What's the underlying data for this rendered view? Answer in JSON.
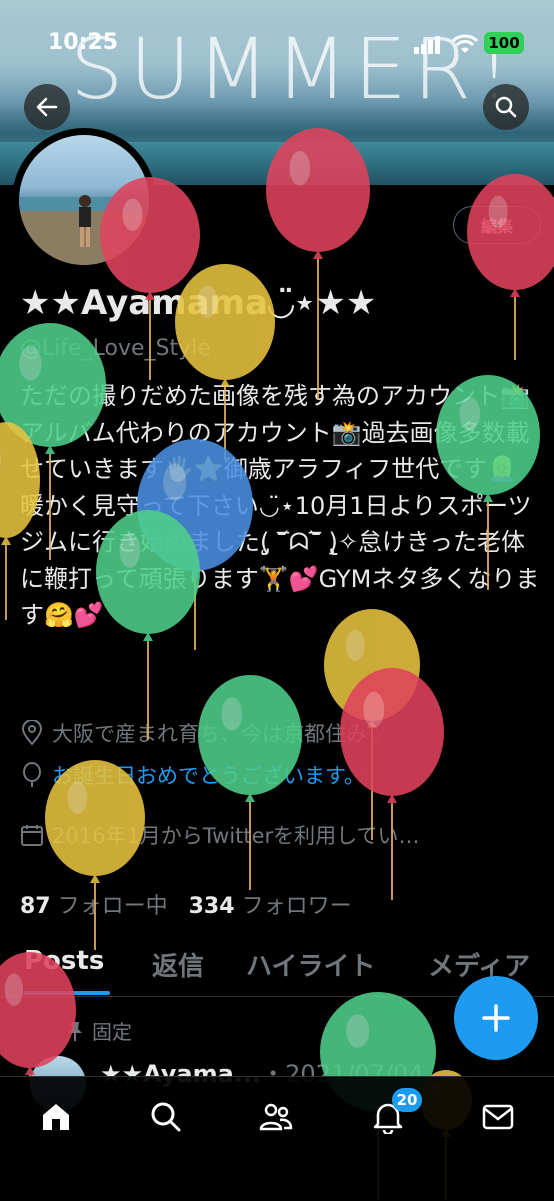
{
  "status_bar": {
    "time": "10:25",
    "battery": "100"
  },
  "banner": {
    "text": "SUMMER!"
  },
  "header": {
    "edit_label": "編集"
  },
  "profile": {
    "name": "★★Ayamama◡̈⋆★★",
    "handle": "@Life_Love_Style",
    "bio": "ただの撮りだめた画像を残す為のアカウント📸アルバム代わりのアカウント📸過去画像多数載せていきます🖐⭐️御歳アラフィフ世代です👱‍♀️暖かく見守って下さい◡̈⋆10月1日よりスポーツジムに行き始めました(̨̡ ‾᷄ᗣ‾᷅ )̧̢✧怠けきった老体に鞭打って頑張ります🏋️💕GYMネタ多くなります🤗💕",
    "location": "大阪で産まれ育ち、今は京都住み♡",
    "birthday": "お誕生日おめでとうございます。",
    "joined": "2016年1月からTwitterを利用してい…",
    "following_count": "87",
    "following_label": "フォロー中",
    "followers_count": "334",
    "followers_label": "フォロワー"
  },
  "tabs": [
    "Posts",
    "返信",
    "ハイライト",
    "メディア"
  ],
  "pinned_label": "固定",
  "post": {
    "author": "★★Ayama...",
    "date": "・2021/07/04"
  },
  "nav": {
    "notifications_badge": "20"
  },
  "colors": {
    "accent": "#1d9bf0",
    "battery": "#31d158"
  },
  "decor": {
    "balloons": [
      {
        "color": "#e0435c"
      },
      {
        "color": "#e0435c"
      },
      {
        "color": "#e0435c"
      },
      {
        "color": "#e8c340"
      },
      {
        "color": "#4fcf8b"
      },
      {
        "color": "#4fcf8b"
      },
      {
        "color": "#4a90e2"
      },
      {
        "color": "#e8c340"
      },
      {
        "color": "#4fcf8b"
      },
      {
        "color": "#e8c340"
      },
      {
        "color": "#e0435c"
      },
      {
        "color": "#4fcf8b"
      },
      {
        "color": "#e8c340"
      },
      {
        "color": "#e0435c"
      },
      {
        "color": "#4fcf8b"
      },
      {
        "color": "#e8c340"
      }
    ]
  }
}
